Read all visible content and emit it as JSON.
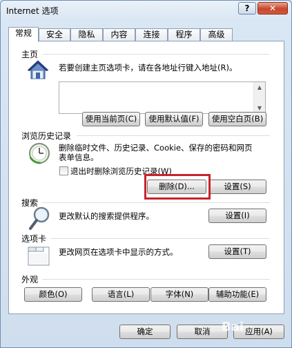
{
  "window": {
    "title": "Internet 选项",
    "help_label": "?",
    "close_label": "✕"
  },
  "tabs": [
    {
      "label": "常规"
    },
    {
      "label": "安全"
    },
    {
      "label": "隐私"
    },
    {
      "label": "内容"
    },
    {
      "label": "连接"
    },
    {
      "label": "程序"
    },
    {
      "label": "高级"
    }
  ],
  "home": {
    "title": "主页",
    "description": "若要创建主页选项卡，请在各地址行键入地址(R)。",
    "url_value": "",
    "buttons": {
      "current": "使用当前页(C)",
      "default": "使用默认值(F)",
      "blank": "使用空白页(B)"
    }
  },
  "history": {
    "title": "浏览历史记录",
    "description_line1": "删除临时文件、历史记录、Cookie、保存的密码和网页",
    "description_line2": "表单信息。",
    "checkbox_label": "退出时删除浏览历史记录(W)",
    "checkbox_checked": false,
    "delete_button": "删除(D)...",
    "settings_button": "设置(S)"
  },
  "search": {
    "title": "搜索",
    "description": "更改默认的搜索提供程序。",
    "settings_button": "设置(I)"
  },
  "tabs_section": {
    "title": "选项卡",
    "description": "更改网页在选项卡中显示的方式。",
    "settings_button": "设置(T)"
  },
  "appearance": {
    "title": "外观",
    "buttons": {
      "colors": "颜色(O)",
      "languages": "语言(L)",
      "fonts": "字体(N)",
      "accessibility": "辅助功能(E)"
    }
  },
  "footer": {
    "ok": "确定",
    "cancel": "取消",
    "apply": "应用(A)"
  },
  "watermark": "Bai"
}
